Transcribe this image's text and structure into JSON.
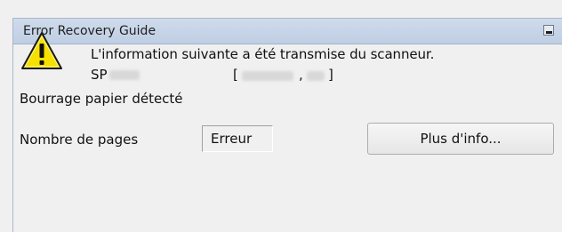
{
  "window": {
    "title": "Error Recovery Guide"
  },
  "message": {
    "line1": "L'information suivante a été transmise du scanneur.",
    "model_prefix": "SP",
    "bracket_open": "[",
    "separator": ",",
    "bracket_close": "]",
    "status": "Bourrage papier détecté"
  },
  "page_count": {
    "label": "Nombre de pages",
    "value": "Erreur"
  },
  "buttons": {
    "more_info": "Plus d'info..."
  },
  "icons": {
    "warning": "warning-icon",
    "minimize": "minimize-icon"
  },
  "colors": {
    "titlebar": "#c6d4e8",
    "warning_fill": "#f5e000",
    "background": "#f0f0f0"
  }
}
